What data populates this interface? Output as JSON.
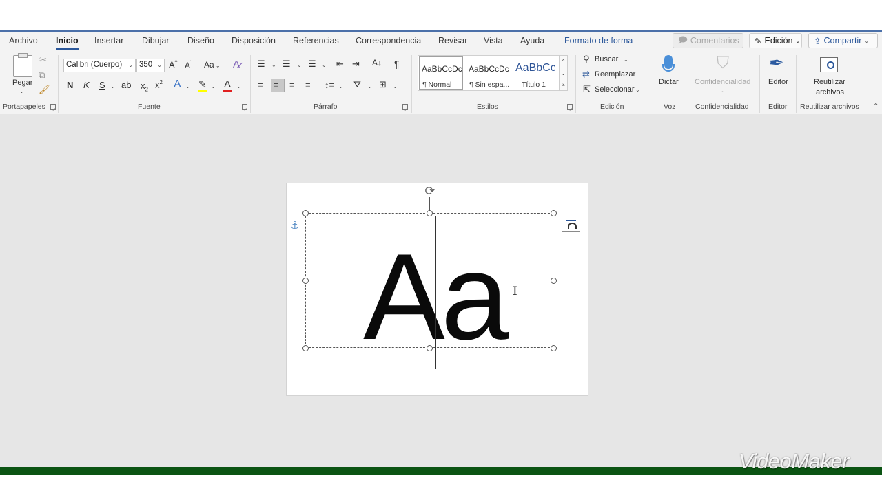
{
  "tabs": [
    {
      "label": "Archivo"
    },
    {
      "label": "Inicio"
    },
    {
      "label": "Insertar"
    },
    {
      "label": "Dibujar"
    },
    {
      "label": "Diseño"
    },
    {
      "label": "Disposición"
    },
    {
      "label": "Referencias"
    },
    {
      "label": "Correspondencia"
    },
    {
      "label": "Revisar"
    },
    {
      "label": "Vista"
    },
    {
      "label": "Ayuda"
    },
    {
      "label": "Formato de forma"
    }
  ],
  "active_tab": "Inicio",
  "top_right": {
    "comments": "Comentarios",
    "editing": "Edición",
    "share": "Compartir"
  },
  "ribbon": {
    "clipboard": {
      "paste": "Pegar",
      "group": "Portapapeles"
    },
    "font": {
      "name": "Calibri (Cuerpo)",
      "size": "350",
      "case_label": "Aa",
      "bold": "N",
      "italic": "K",
      "underline": "S",
      "strike": "ab",
      "subscript": "x",
      "superscript": "x",
      "group": "Fuente"
    },
    "paragraph": {
      "group": "Párrafo"
    },
    "styles": {
      "items": [
        {
          "sample": "AaBbCcDc",
          "name": "¶ Normal"
        },
        {
          "sample": "AaBbCcDc",
          "name": "¶ Sin espa..."
        },
        {
          "sample": "AaBbCc",
          "name": "Título 1"
        }
      ],
      "group": "Estilos"
    },
    "editing": {
      "find": "Buscar",
      "replace": "Reemplazar",
      "select": "Seleccionar",
      "group": "Edición"
    },
    "voice": {
      "dictate": "Dictar",
      "group": "Voz"
    },
    "confidentiality": {
      "label": "Confidencialidad",
      "group": "Confidencialidad"
    },
    "editor": {
      "label": "Editor",
      "group": "Editor"
    },
    "reuse": {
      "line1": "Reutilizar",
      "line2": "archivos",
      "group": "Reutilizar archivos"
    }
  },
  "document": {
    "textbox_text": "Aa"
  },
  "watermark": "VideoMaker",
  "colors": {
    "accent": "#2b579a",
    "bottom_bar": "#0b5413",
    "highlight": "#ffff00",
    "font_color": "#e02020"
  }
}
